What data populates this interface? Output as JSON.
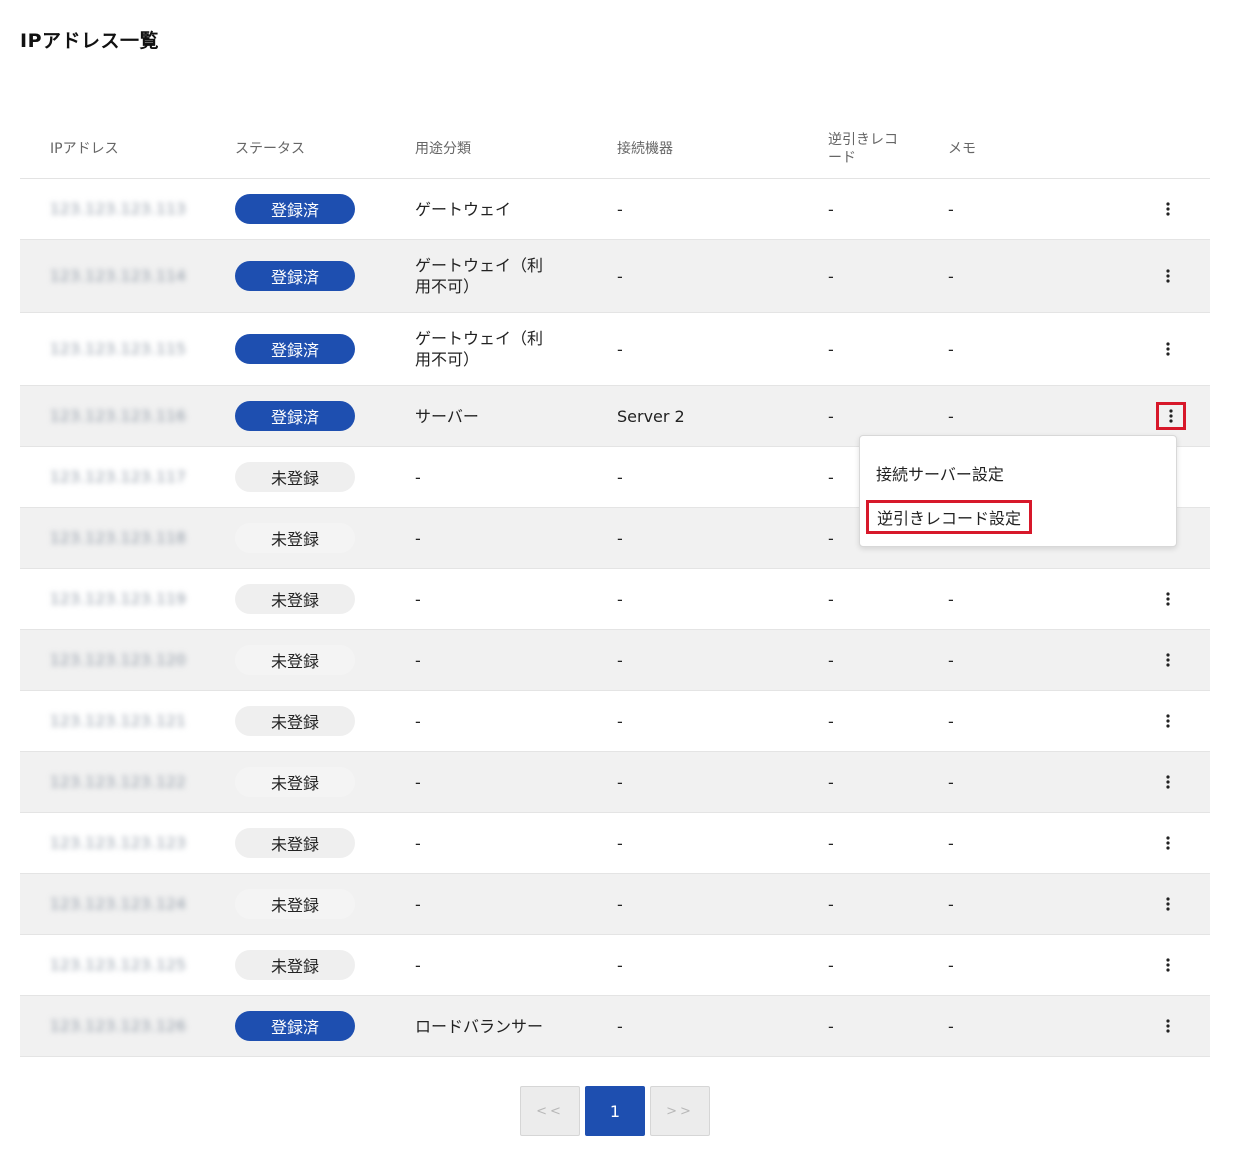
{
  "page": {
    "title": "IPアドレス一覧"
  },
  "table": {
    "headers": {
      "ip": "IPアドレス",
      "status": "ステータス",
      "usage": "用途分類",
      "device": "接続機器",
      "reverse": "逆引きレコード",
      "memo": "メモ"
    },
    "rows": [
      {
        "ip": "123.123.123.113",
        "status": "登録済",
        "usage": "ゲートウェイ",
        "device": "-",
        "reverse": "-",
        "memo": "-"
      },
      {
        "ip": "123.123.123.114",
        "status": "登録済",
        "usage": "ゲートウェイ（利用不可）",
        "device": "-",
        "reverse": "-",
        "memo": "-"
      },
      {
        "ip": "123.123.123.115",
        "status": "登録済",
        "usage": "ゲートウェイ（利用不可）",
        "device": "-",
        "reverse": "-",
        "memo": "-"
      },
      {
        "ip": "123.123.123.116",
        "status": "登録済",
        "usage": "サーバー",
        "device": "Server 2",
        "reverse": "-",
        "memo": "-"
      },
      {
        "ip": "123.123.123.117",
        "status": "未登録",
        "usage": "-",
        "device": "-",
        "reverse": "-",
        "memo": ""
      },
      {
        "ip": "123.123.123.118",
        "status": "未登録",
        "usage": "-",
        "device": "-",
        "reverse": "-",
        "memo": ""
      },
      {
        "ip": "123.123.123.119",
        "status": "未登録",
        "usage": "-",
        "device": "-",
        "reverse": "-",
        "memo": "-"
      },
      {
        "ip": "123.123.123.120",
        "status": "未登録",
        "usage": "-",
        "device": "-",
        "reverse": "-",
        "memo": "-"
      },
      {
        "ip": "123.123.123.121",
        "status": "未登録",
        "usage": "-",
        "device": "-",
        "reverse": "-",
        "memo": "-"
      },
      {
        "ip": "123.123.123.122",
        "status": "未登録",
        "usage": "-",
        "device": "-",
        "reverse": "-",
        "memo": "-"
      },
      {
        "ip": "123.123.123.123",
        "status": "未登録",
        "usage": "-",
        "device": "-",
        "reverse": "-",
        "memo": "-"
      },
      {
        "ip": "123.123.123.124",
        "status": "未登録",
        "usage": "-",
        "device": "-",
        "reverse": "-",
        "memo": "-"
      },
      {
        "ip": "123.123.123.125",
        "status": "未登録",
        "usage": "-",
        "device": "-",
        "reverse": "-",
        "memo": "-"
      },
      {
        "ip": "123.123.123.126",
        "status": "登録済",
        "usage": "ロードバランサー",
        "device": "-",
        "reverse": "-",
        "memo": "-"
      }
    ]
  },
  "context_menu": {
    "items": [
      "接続サーバー設定",
      "逆引きレコード設定"
    ]
  },
  "pagination": {
    "prev": "<<",
    "current": "1",
    "next": ">>"
  },
  "colors": {
    "accent": "#1e4fb0",
    "highlight": "#d7182a",
    "row_alt": "#f1f1f1",
    "badge_unregistered": "#efefef"
  },
  "icons": {
    "row_action": "more-vertical-icon"
  }
}
